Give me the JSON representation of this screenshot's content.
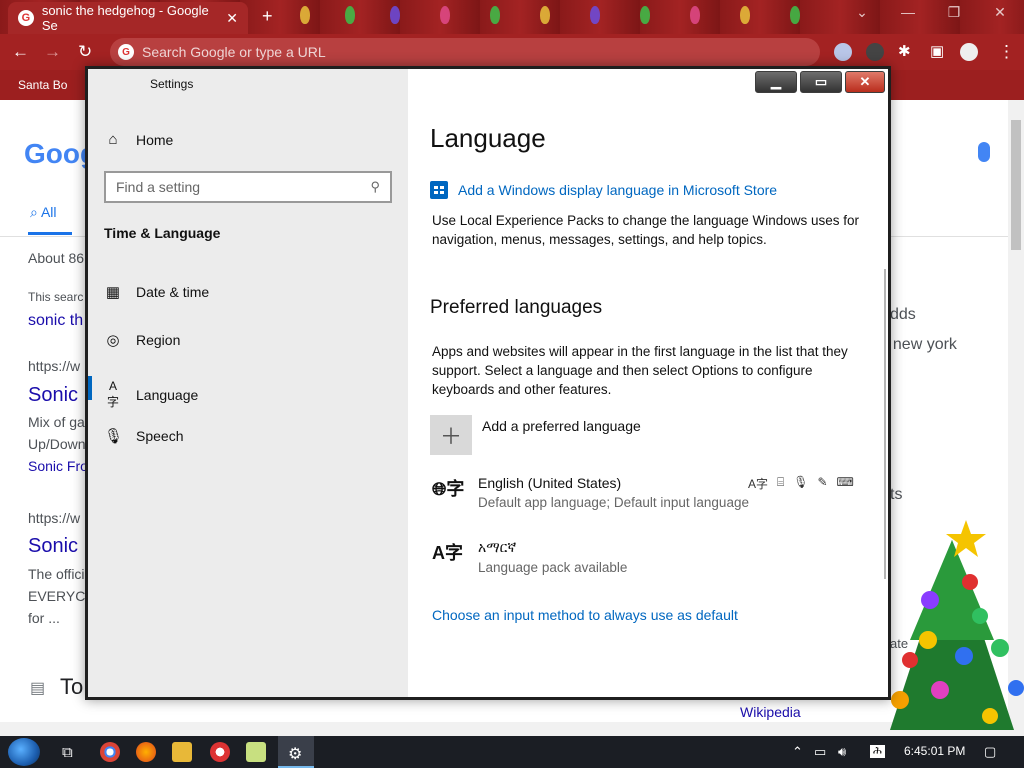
{
  "browser": {
    "tab_title": "sonic the hedgehog - Google Se",
    "tab_close": "✕",
    "new_tab": "+",
    "omnibox_placeholder": "Search Google or type a URL",
    "bookmark": "Santa Bo",
    "window_controls": [
      "⌄",
      "—",
      "❐",
      "✕"
    ]
  },
  "google": {
    "logo": "Goog",
    "all_tab": "All",
    "results_count": "About 86",
    "snippet_prefix": "This searc",
    "did_you_mean": "sonic th",
    "result1": {
      "url": "https://w",
      "title": "Sonic",
      "line1": "Mix of ga",
      "line2": "Up/Down",
      "sublink": "Sonic Fro"
    },
    "result2": {
      "url": "https://w",
      "title": "Sonic",
      "line1": "The offici",
      "line2": "EVERYC",
      "line3": "for ..."
    },
    "bottom_heading": "To",
    "right_col": [
      "dds",
      "t new york",
      "t",
      "ts",
      "ate"
    ],
    "wikipedia": "Wikipedia"
  },
  "settings": {
    "window_title": "Settings",
    "caption": {
      "min": "▁",
      "max": "▭",
      "close": "✕"
    },
    "nav": {
      "home": "Home",
      "search_placeholder": "Find a setting",
      "section": "Time & Language",
      "items": [
        "Date & time",
        "Region",
        "Language",
        "Speech"
      ]
    },
    "page_title": "Language",
    "store_link": "Add a Windows display language in Microsoft Store",
    "store_desc": "Use Local Experience Packs to change the language Windows uses for navigation, menus, messages, settings, and help topics.",
    "preferred_heading": "Preferred languages",
    "preferred_desc": "Apps and websites will appear in the first language in the list that they support. Select a language and then select Options to configure keyboards and other features.",
    "add_language": "Add a preferred language",
    "languages": [
      {
        "name": "English (United States)",
        "detail": "Default app language; Default input language"
      },
      {
        "name": "አማርኛ",
        "detail": "Language pack available"
      }
    ],
    "input_method_link": "Choose an input method to always use as default"
  },
  "taskbar": {
    "clock": "6:45:01 PM"
  },
  "colors": {
    "accent": "#0067c0",
    "sidebar_bg": "#ececec",
    "chrome_theme": "#a32222"
  }
}
